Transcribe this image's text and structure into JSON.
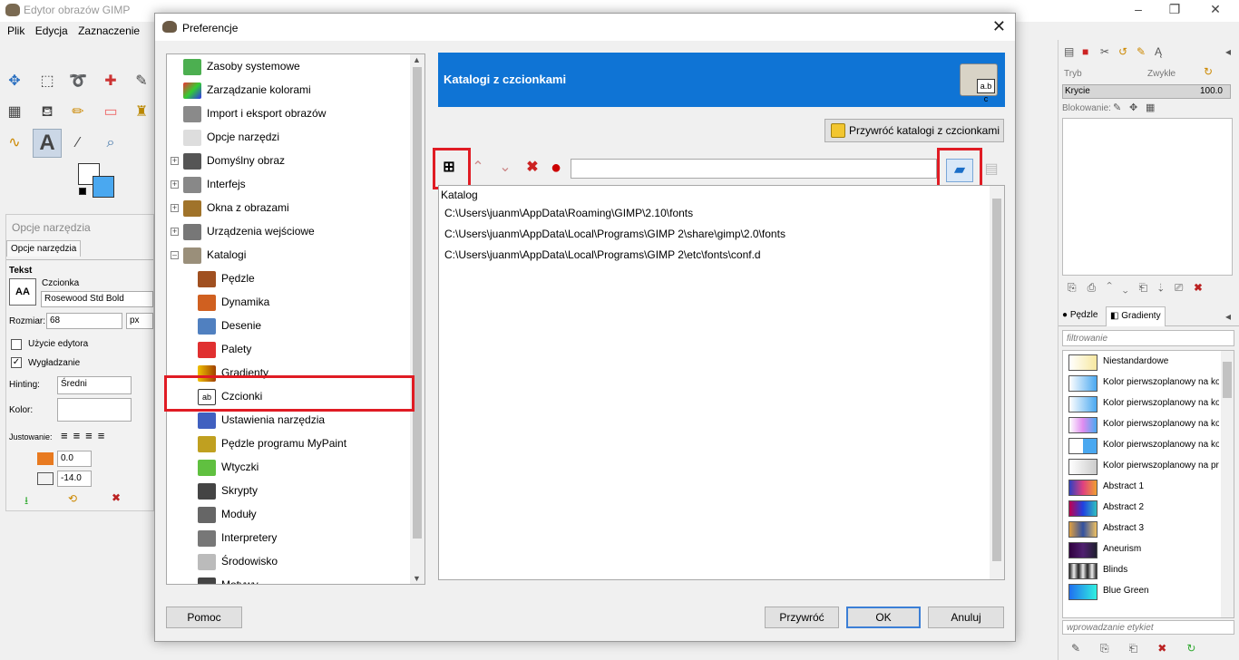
{
  "app": {
    "title": "Edytor obrazów GIMP",
    "menu": [
      "Plik",
      "Edycja",
      "Zaznaczenie"
    ],
    "window_controls": [
      "–",
      "❐",
      "✕"
    ]
  },
  "tool_options": {
    "header": "Opcje narzędzia",
    "tab": "Opcje narzędzia",
    "section": "Tekst",
    "font_label": "Czcionka",
    "font_value": "Rosewood Std Bold",
    "font_preview": "AA",
    "size_label": "Rozmiar:",
    "size_value": "68",
    "size_unit": "px",
    "use_editor": "Użycie edytora",
    "antialias": "Wygładzanie",
    "hinting_label": "Hinting:",
    "hinting_value": "Średni",
    "color_label": "Kolor:",
    "justify_label": "Justowanie:",
    "indent_value": "0.0",
    "spacing_value": "-14.0"
  },
  "dialog": {
    "title": "Preferencje",
    "close": "✕",
    "nav": [
      {
        "label": "Zasoby systemowe"
      },
      {
        "label": "Zarządzanie kolorami"
      },
      {
        "label": "Import i eksport obrazów"
      },
      {
        "label": "Opcje narzędzi"
      },
      {
        "label": "Domyślny obraz"
      },
      {
        "label": "Interfejs"
      },
      {
        "label": "Okna z obrazami"
      },
      {
        "label": "Urządzenia wejściowe"
      },
      {
        "label": "Katalogi"
      },
      {
        "label": "Pędzle"
      },
      {
        "label": "Dynamika"
      },
      {
        "label": "Desenie"
      },
      {
        "label": "Palety"
      },
      {
        "label": "Gradienty"
      },
      {
        "label": "Czcionki"
      },
      {
        "label": "Ustawienia narzędzia"
      },
      {
        "label": "Pędzle programu MyPaint"
      },
      {
        "label": "Wtyczki"
      },
      {
        "label": "Skrypty"
      },
      {
        "label": "Moduły"
      },
      {
        "label": "Interpretery"
      },
      {
        "label": "Środowisko"
      },
      {
        "label": "Motywy"
      }
    ],
    "banner_title": "Katalogi z czcionkami",
    "banner_icon_text": "a.b c",
    "reset_button": "Przywróć katalogi z czcionkami",
    "column_header": "Katalog",
    "folders": [
      "C:\\Users\\juanm\\AppData\\Roaming\\GIMP\\2.10\\fonts",
      "C:\\Users\\juanm\\AppData\\Local\\Programs\\GIMP 2\\share\\gimp\\2.0\\fonts",
      "C:\\Users\\juanm\\AppData\\Local\\Programs\\GIMP 2\\etc\\fonts\\conf.d"
    ],
    "help_button": "Pomoc",
    "restore_button": "Przywróć",
    "ok_button": "OK",
    "cancel_button": "Anuluj"
  },
  "right_dock": {
    "mode_label": "Tryb",
    "mode_value": "Zwykłe",
    "opacity_label": "Krycie",
    "opacity_value": "100.0",
    "lock_label": "Blokowanie:",
    "tab_brushes": "Pędzle",
    "tab_gradients": "Gradienty",
    "filter_placeholder": "filtrowanie",
    "tag_placeholder": "wprowadzanie etykiet",
    "gradients": [
      {
        "name": "Niestandardowe",
        "css": "linear-gradient(90deg,#fff 0%,#f7e8a0 100%)"
      },
      {
        "name": "Kolor pierwszoplanowy na kolor tła (RGB)",
        "css": "linear-gradient(90deg,#fff,#4aa8f0)"
      },
      {
        "name": "Kolor pierwszoplanowy na kolor tła (HSV)",
        "css": "linear-gradient(90deg,#fff,#4aa8f0)"
      },
      {
        "name": "Kolor pierwszoplanowy na kolor tła (HSV)",
        "css": "linear-gradient(90deg,#fff,#e08cf0,#4aa8f0)"
      },
      {
        "name": "Kolor pierwszoplanowy na kolor tła (ostry)",
        "css": "linear-gradient(90deg,#fff 50%,#4aa8f0 50%)"
      },
      {
        "name": "Kolor pierwszoplanowy na przezroczystość",
        "css": "linear-gradient(90deg,#fff,#ccc)"
      },
      {
        "name": "Abstract 1",
        "css": "linear-gradient(90deg,#3040c0,#e04080,#f0a030)"
      },
      {
        "name": "Abstract 2",
        "css": "linear-gradient(90deg,#c00050,#2040e0,#30c0c0)"
      },
      {
        "name": "Abstract 3",
        "css": "linear-gradient(90deg,#e0a040,#3050a0,#f0c060)"
      },
      {
        "name": "Aneurism",
        "css": "linear-gradient(90deg,#300040,#502070,#202030)"
      },
      {
        "name": "Blinds",
        "css": "repeating-linear-gradient(90deg,#222 0px,#eee 5px,#222 10px)"
      },
      {
        "name": "Blue Green",
        "css": "linear-gradient(90deg,#2070f0,#30f0e0)"
      }
    ]
  }
}
